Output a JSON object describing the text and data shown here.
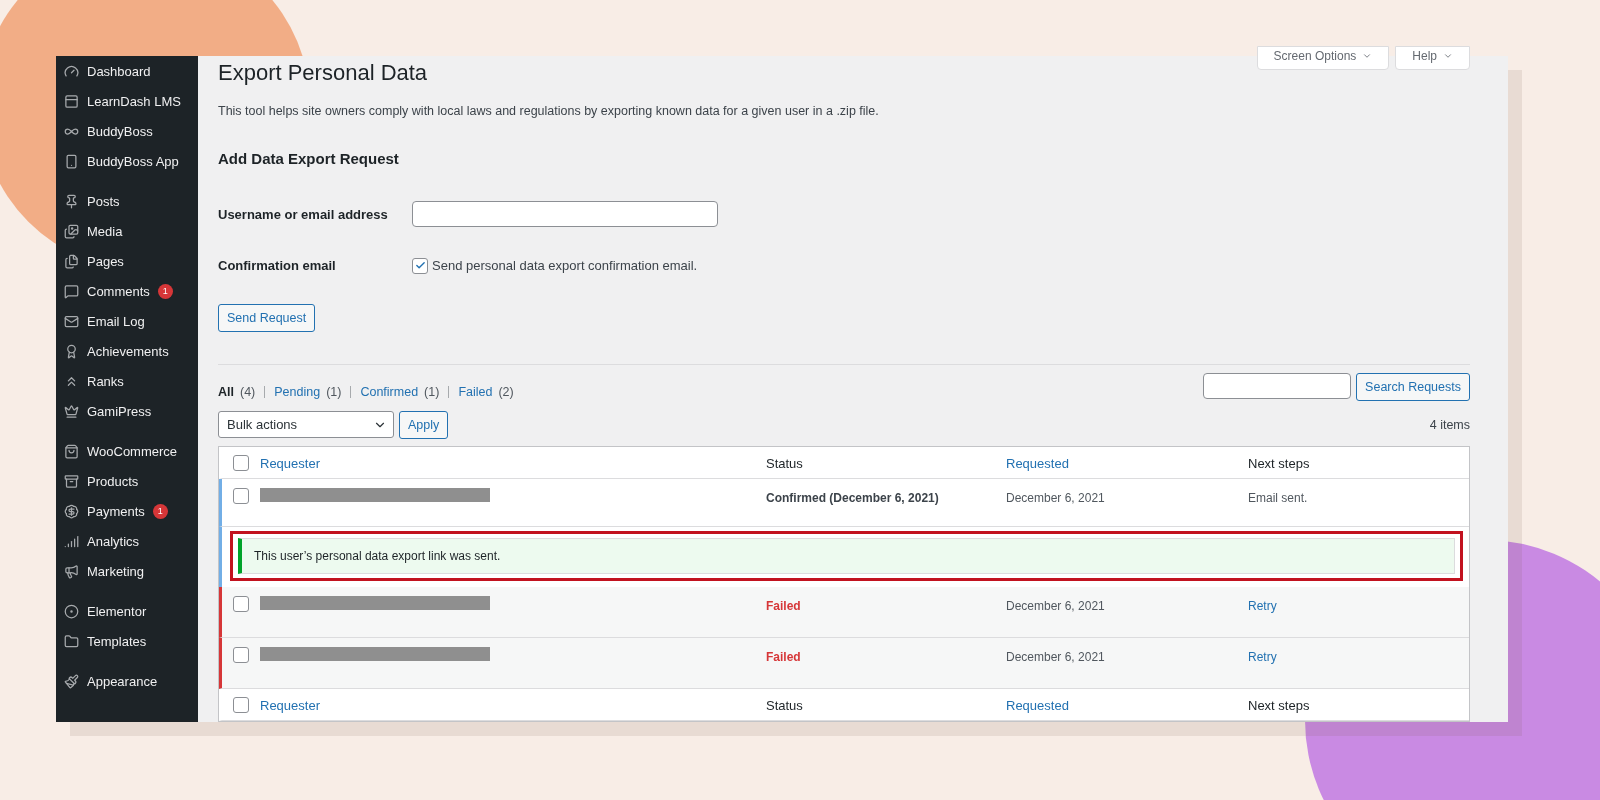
{
  "sidebar": {
    "groups": [
      [
        {
          "label": "Dashboard"
        },
        {
          "label": "LearnDash LMS"
        },
        {
          "label": "BuddyBoss"
        },
        {
          "label": "BuddyBoss App"
        }
      ],
      [
        {
          "label": "Posts"
        },
        {
          "label": "Media"
        },
        {
          "label": "Pages"
        },
        {
          "label": "Comments",
          "badge": "1"
        },
        {
          "label": "Email Log"
        },
        {
          "label": "Achievements"
        },
        {
          "label": "Ranks"
        },
        {
          "label": "GamiPress"
        }
      ],
      [
        {
          "label": "WooCommerce"
        },
        {
          "label": "Products"
        },
        {
          "label": "Payments",
          "badge": "1"
        },
        {
          "label": "Analytics"
        },
        {
          "label": "Marketing"
        }
      ],
      [
        {
          "label": "Elementor"
        },
        {
          "label": "Templates"
        }
      ],
      [
        {
          "label": "Appearance"
        }
      ]
    ]
  },
  "top_buttons": [
    "Screen Options",
    "Help"
  ],
  "page": {
    "title": "Export Personal Data",
    "description": "This tool helps site owners comply with local laws and regulations by exporting known data for a given user in a .zip file."
  },
  "form": {
    "heading": "Add Data Export Request",
    "username_label": "Username or email address",
    "confirmation_label": "Confirmation email",
    "confirmation_text": "Send personal data export confirmation email.",
    "confirmation_checked": true,
    "submit": "Send Request"
  },
  "filters": [
    {
      "label": "All",
      "count": "(4)",
      "selected": true
    },
    {
      "label": "Pending",
      "count": "(1)",
      "selected": false
    },
    {
      "label": "Confirmed",
      "count": "(1)",
      "selected": false
    },
    {
      "label": "Failed",
      "count": "(2)",
      "selected": false
    }
  ],
  "search_button": "Search Requests",
  "bulk": {
    "value": "Bulk actions",
    "apply": "Apply"
  },
  "item_count": "4 items",
  "table": {
    "select_all_checked": false,
    "columns": [
      {
        "label": "Requester",
        "sortable": true
      },
      {
        "label": "Status",
        "sortable": false
      },
      {
        "label": "Requested",
        "sortable": true
      },
      {
        "label": "Next steps",
        "sortable": false
      }
    ],
    "footer_select_all_checked": false,
    "footer_columns": [
      {
        "label": "Requester",
        "sortable": true
      },
      {
        "label": "Status",
        "sortable": false
      },
      {
        "label": "Requested",
        "sortable": true
      },
      {
        "label": "Next steps",
        "sortable": false
      }
    ],
    "rows": [
      {
        "kind": "confirmed",
        "checked": false,
        "status": "Confirmed (December 6, 2021)",
        "requested": "December 6, 2021",
        "next_step": "Email sent.",
        "next_step_link": false,
        "notice": "This user’s personal data export link was sent.",
        "notice_highlighted": true
      },
      {
        "kind": "failed",
        "checked": false,
        "status": "Failed",
        "requested": "December 6, 2021",
        "next_step": "Retry",
        "next_step_link": true
      },
      {
        "kind": "failed",
        "checked": false,
        "status": "Failed",
        "requested": "December 6, 2021",
        "next_step": "Retry",
        "next_step_link": true
      }
    ]
  }
}
